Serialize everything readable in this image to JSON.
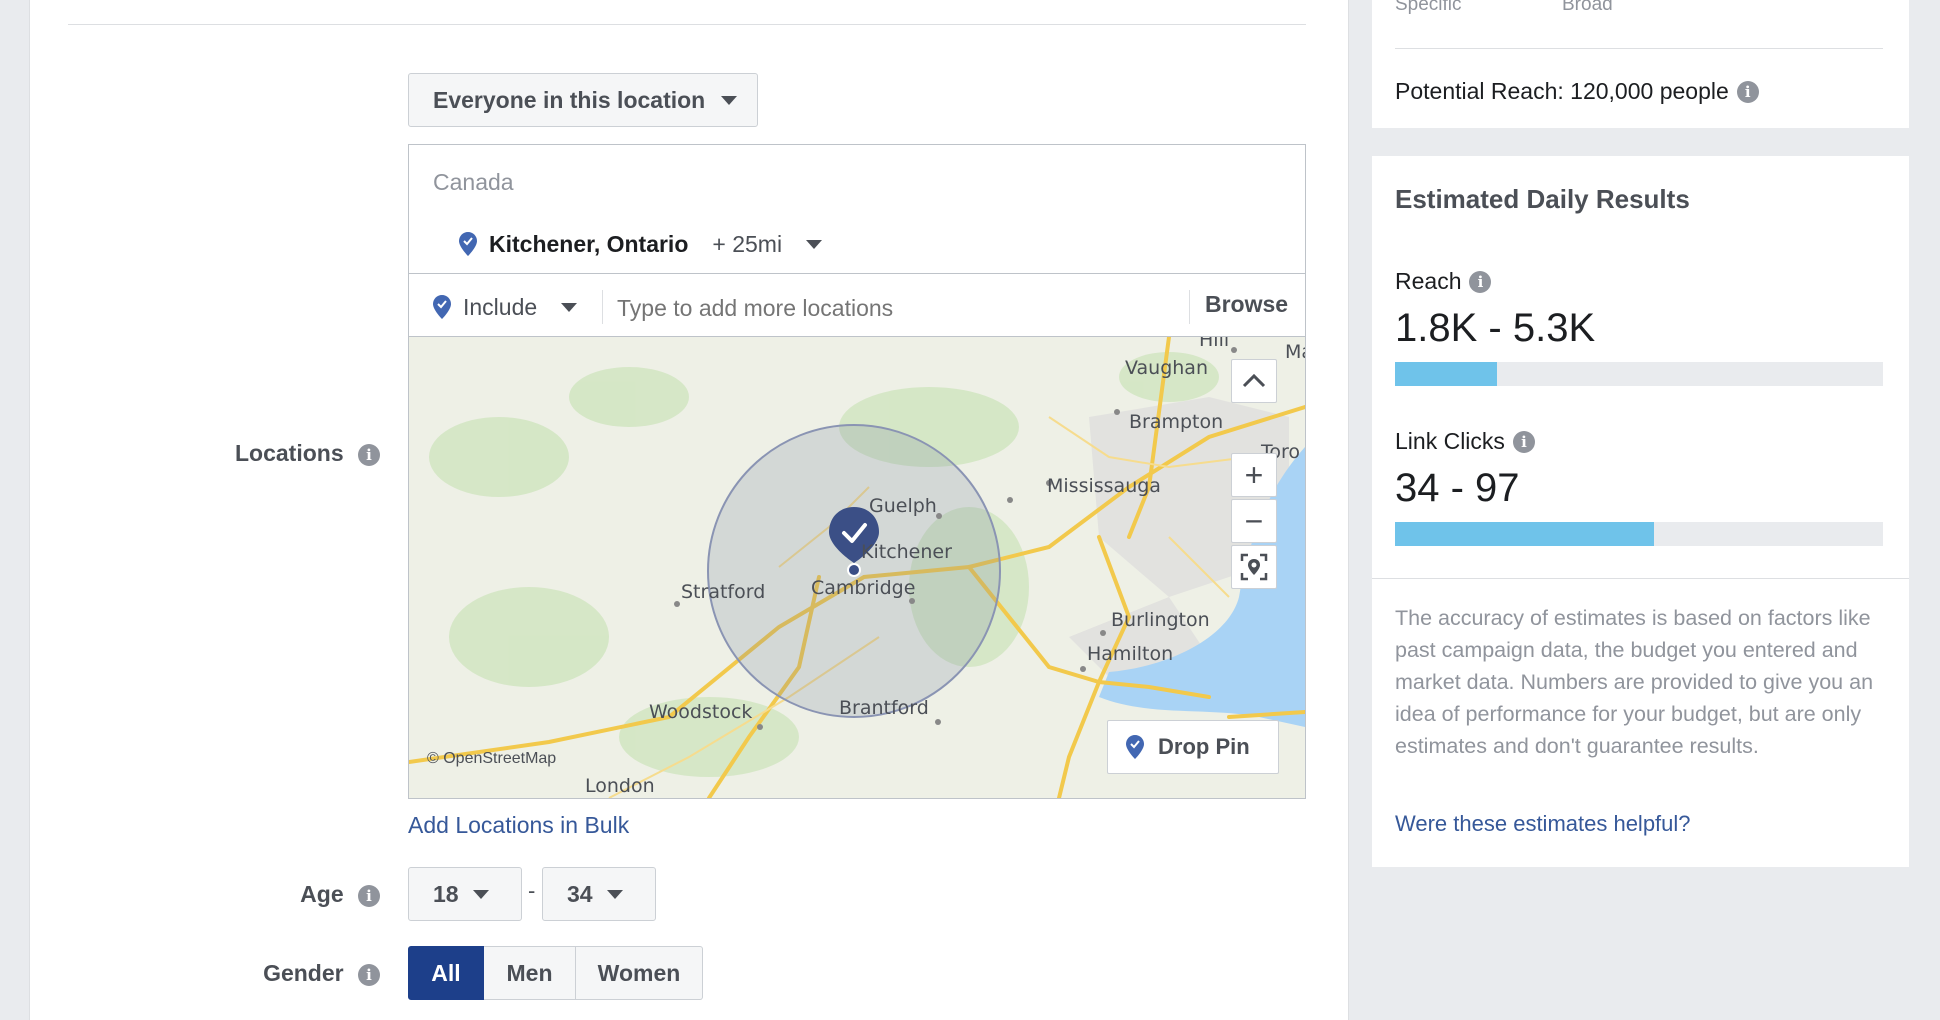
{
  "targeting": {
    "location_type_label": "Everyone in this location",
    "country": "Canada",
    "selected_location": "Kitchener, Ontario",
    "radius": "+ 25mi",
    "include_label": "Include",
    "search_placeholder": "Type to add more locations",
    "browse_label": "Browse",
    "locations_label": "Locations",
    "add_bulk_label": "Add Locations in Bulk",
    "age_label": "Age",
    "age_min": "18",
    "age_separator": "-",
    "age_max": "34",
    "gender_label": "Gender",
    "gender_options": [
      "All",
      "Men",
      "Women"
    ],
    "gender_selected": "All"
  },
  "map": {
    "places": [
      "Hill",
      "Ma",
      "Vaughan",
      "Brampton",
      "Toro",
      "Mississauga",
      "Guelph",
      "Kitchener",
      "Stratford",
      "Cambridge",
      "Burlington",
      "Hamilton",
      "Woodstock",
      "Brantford",
      "London"
    ],
    "copyright": "© OpenStreetMap",
    "drop_pin_label": "Drop Pin",
    "zoom_in": "+",
    "zoom_out": "−"
  },
  "audience": {
    "scale_left": "Specific",
    "scale_right": "Broad",
    "potential_reach": "Potential Reach: 120,000 people"
  },
  "estimates": {
    "title": "Estimated Daily Results",
    "reach_label": "Reach",
    "reach_value": "1.8K - 5.3K",
    "reach_fill_fraction": 0.21,
    "clicks_label": "Link Clicks",
    "clicks_value": "34 - 97",
    "clicks_fill_fraction": 0.53,
    "disclaimer": "The accuracy of estimates is based on factors like past campaign data, the budget you entered and market data. Numbers are provided to give you an idea of performance for your budget, but are only estimates and don't guarantee results.",
    "feedback_link": "Were these estimates helpful?"
  },
  "colors": {
    "accent": "#4267b2",
    "selected_button": "#1d3f8a",
    "bar_fill": "#6fc3ea",
    "water": "#a9d3f5",
    "radius_circle": "#8a94b3"
  }
}
